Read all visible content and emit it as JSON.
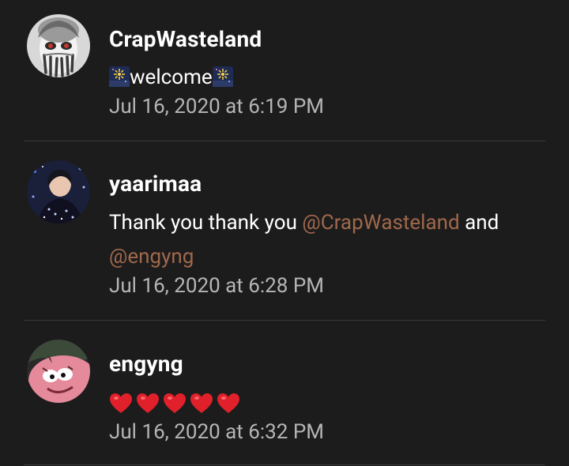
{
  "comments": [
    {
      "username": "CrapWasteland",
      "avatar_icon": "masked-face-avatar",
      "message_prefix_icon": "fireworks-icon",
      "message": "welcome",
      "message_suffix_icon": "fireworks-icon",
      "timestamp": "Jul 16, 2020 at 6:19 PM"
    },
    {
      "username": "yaarimaa",
      "avatar_icon": "sparkle-portrait-avatar",
      "message_parts": [
        {
          "type": "text",
          "value": "Thank you thank you "
        },
        {
          "type": "mention",
          "value": "@CrapWasteland"
        },
        {
          "type": "text",
          "value": " and "
        },
        {
          "type": "mention",
          "value": "@engyng"
        }
      ],
      "timestamp": "Jul 16, 2020 at 6:28 PM"
    },
    {
      "username": "engyng",
      "avatar_icon": "patrick-avatar",
      "message_icons": [
        "red-heart-icon",
        "red-heart-icon",
        "red-heart-icon",
        "red-heart-icon",
        "red-heart-icon"
      ],
      "timestamp": "Jul 16, 2020 at 6:32 PM"
    }
  ],
  "colors": {
    "background": "#1c1c1c",
    "divider": "#3a3a3a",
    "text": "#ffffff",
    "timestamp": "#b5b5b5",
    "mention": "#a0684c",
    "heart": "#e0202a"
  }
}
